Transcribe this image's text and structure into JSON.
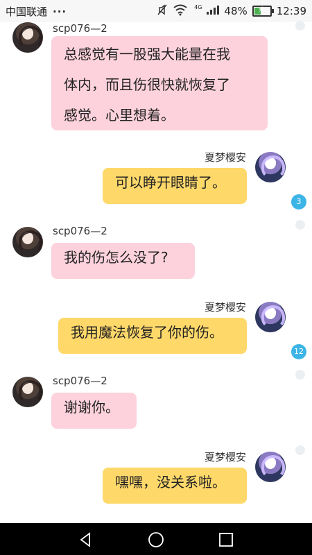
{
  "status_bar": {
    "carrier": "中国联通",
    "more": "···",
    "network": "4G",
    "battery": "48%",
    "time": "12:39",
    "battery_level": 0.48,
    "icons": [
      "mute-icon",
      "wifi-icon",
      "signal-icon",
      "battery-icon"
    ]
  },
  "chat": {
    "messages": [
      {
        "sender": "scp076—2",
        "text_lines": [
          "总感觉有一股强大能量在我",
          "体内，而且伤很快就恢复了",
          "感觉。心里想着。"
        ],
        "side": "left"
      },
      {
        "sender": "夏梦樱安",
        "text": "可以睁开眼睛了。",
        "side": "right",
        "badge": "3"
      },
      {
        "sender": "scp076—2",
        "text": "我的伤怎么没了?",
        "side": "left"
      },
      {
        "sender": "夏梦樱安",
        "text": "我用魔法恢复了你的伤。",
        "side": "right",
        "badge": "12"
      },
      {
        "sender": "scp076—2",
        "text": "谢谢你。",
        "side": "left"
      },
      {
        "sender": "夏梦樱安",
        "text": "嘿嘿，没关系啦。",
        "side": "right"
      }
    ]
  },
  "navigation_bar": {
    "buttons": [
      "back-icon",
      "home-icon",
      "recent-apps-icon"
    ]
  },
  "colors": {
    "left_bubble": "#fdd2dd",
    "right_bubble": "#ffd86a",
    "badge": "#3db4e6",
    "nav_bar": "#000000"
  }
}
